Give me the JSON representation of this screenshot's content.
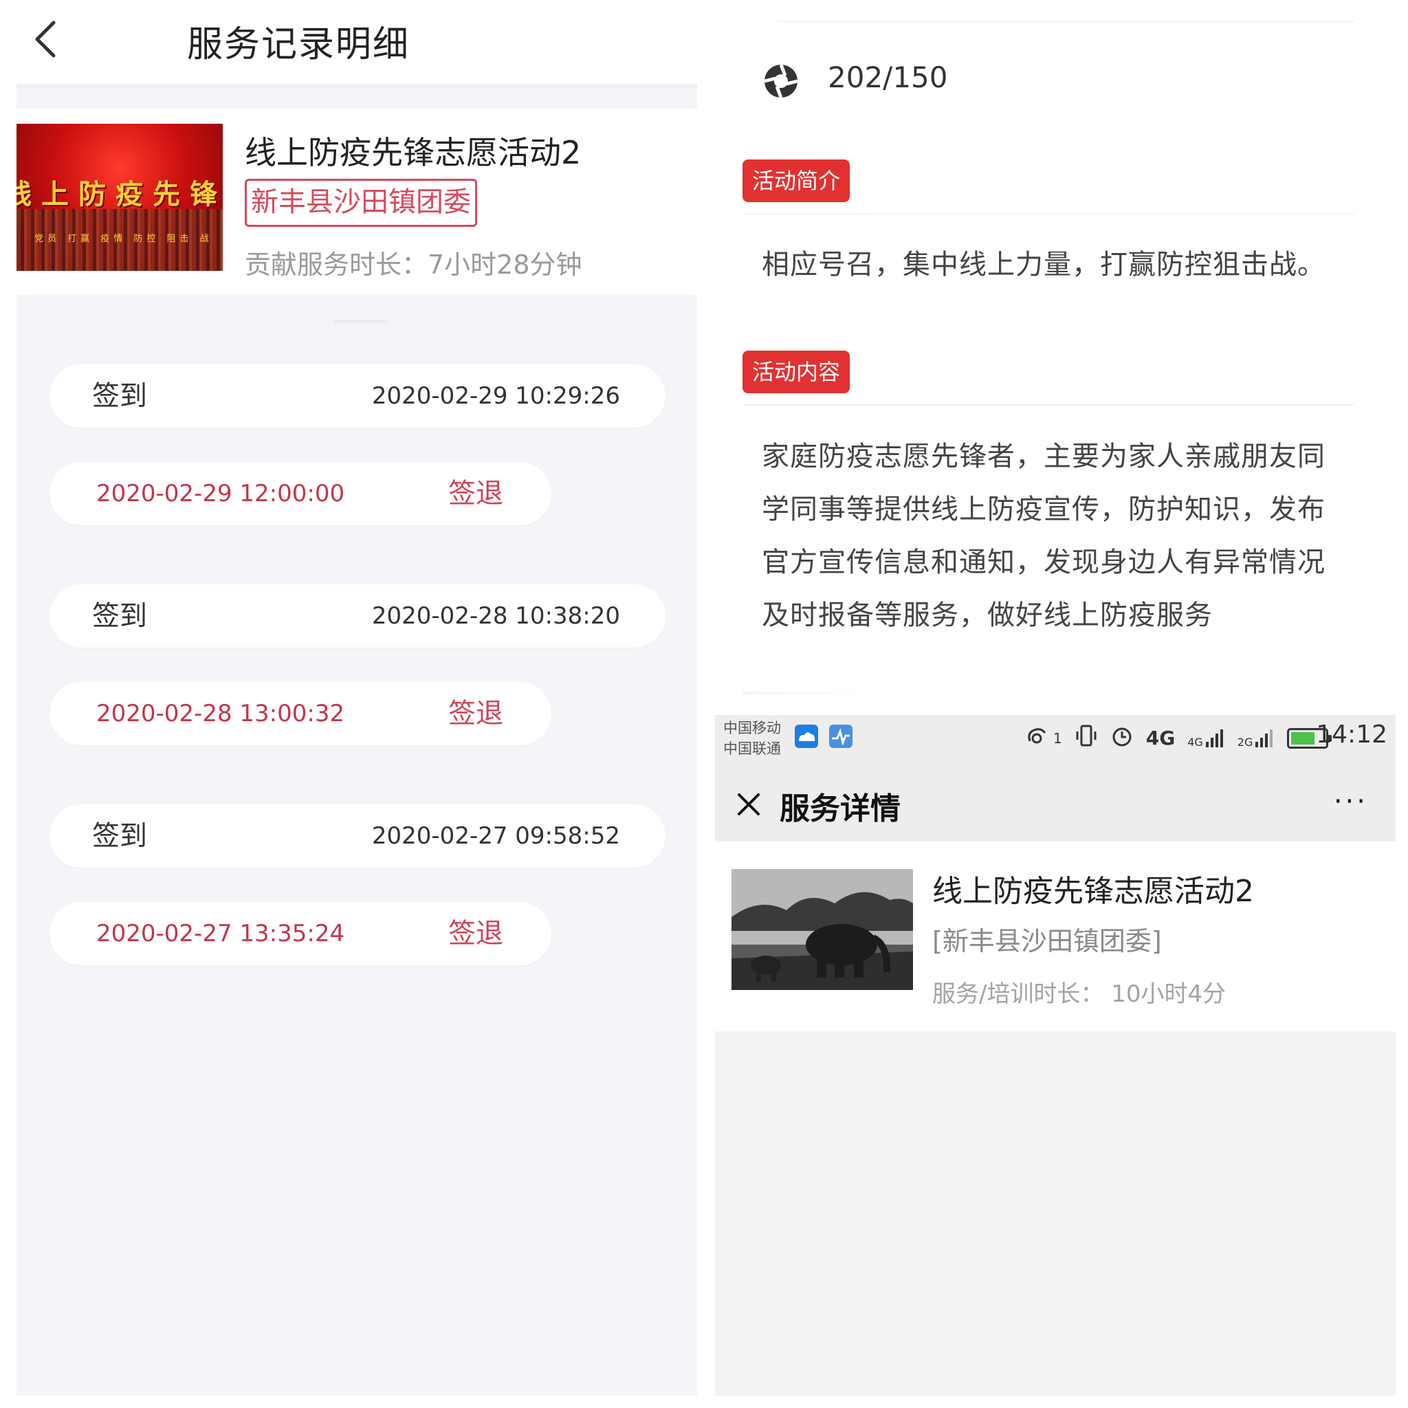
{
  "left": {
    "nav_title": "服务记录明细",
    "card": {
      "thumb_title": "线上防疫先锋",
      "thumb_sub": "党员 打赢 疫情 防控 阻击 战",
      "title": "线上防疫先锋志愿活动2",
      "org": "新丰县沙田镇团委",
      "duration": "贡献服务时长：7小时28分钟"
    },
    "records": [
      {
        "type": "in",
        "label": "签到",
        "time": "2020-02-29 10:29:26"
      },
      {
        "type": "out",
        "label": "签退",
        "time": "2020-02-29 12:00:00"
      },
      {
        "type": "in",
        "label": "签到",
        "time": "2020-02-28 10:38:20"
      },
      {
        "type": "out",
        "label": "签退",
        "time": "2020-02-28 13:00:32"
      },
      {
        "type": "in",
        "label": "签到",
        "time": "2020-02-27 09:58:52"
      },
      {
        "type": "out",
        "label": "签退",
        "time": "2020-02-27 13:35:24"
      }
    ]
  },
  "right_top": {
    "count": "202/150",
    "intro_tag": "活动简介",
    "intro_text": "相应号召，集中线上力量，打赢防控狙击战。",
    "content_tag": "活动内容",
    "content_lines": [
      "家庭防疫志愿先锋者，主要为家人亲戚朋友同",
      "学同事等提供线上防疫宣传，防护知识，发布",
      "官方宣传信息和通知，发现身边人有异常情况",
      "及时报备等服务，做好线上防疫服务"
    ]
  },
  "right_bottom": {
    "status": {
      "carrier1": "中国移动",
      "carrier2": "中国联通",
      "sim_badge": "1",
      "net1": "4G",
      "net2": "4G",
      "net3": "2G",
      "time": "14:12"
    },
    "appbar_title": "服务详情",
    "more": "···",
    "card": {
      "title": "线上防疫先锋志愿活动2",
      "org": "[新丰县沙田镇团委]",
      "duration": "服务/培训时长：  10小时4分"
    }
  },
  "colors": {
    "accent_red": "#e23131",
    "out_red": "#c5354a",
    "panel_bg": "#f4f5f9",
    "battery_green": "#4ec24e"
  }
}
